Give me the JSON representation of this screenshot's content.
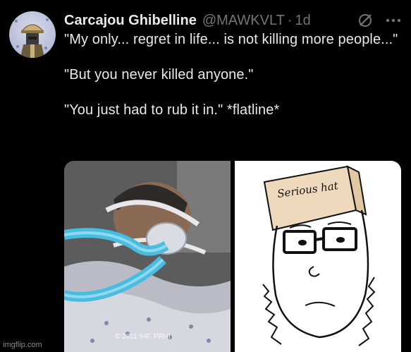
{
  "tweet": {
    "display_name": "Carcajou Ghibelline",
    "handle": "@MAWKVLT",
    "separator": "·",
    "time": "1d",
    "paragraphs": [
      "\"My only... regret in life... is not killing more people...\"",
      "\"But you never killed anyone.\"",
      "\"You just had to rub it in.\" *flatline*"
    ]
  },
  "media": {
    "photo_credit": "© 2011 IHF, PRHI",
    "hat_text": "Serious hat"
  },
  "watermark": "imgflip.com",
  "icons": {
    "avatar": "avatar-image",
    "grok": "grok-icon",
    "more": "more-options-icon"
  },
  "colors": {
    "background": "#000000",
    "text_primary": "#e7e9ea",
    "text_secondary": "#71767b"
  }
}
